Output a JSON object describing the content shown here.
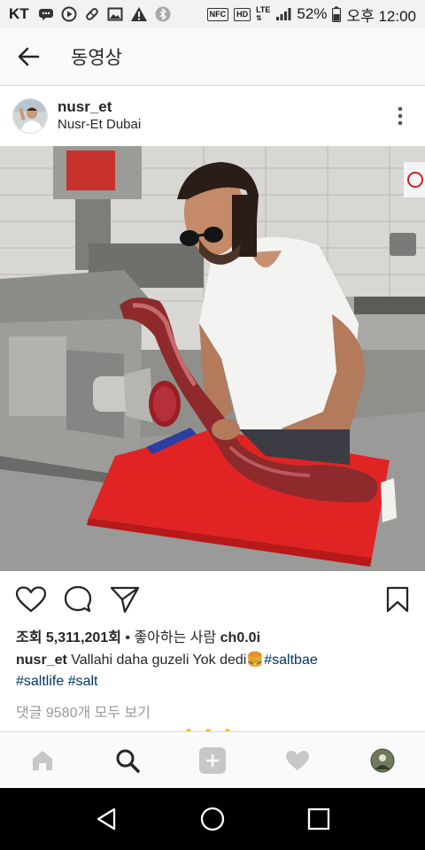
{
  "status_bar": {
    "carrier": "KT",
    "nfc": "NFC",
    "hd": "HD",
    "lte": "LTE",
    "battery": "52%",
    "time": "오후 12:00"
  },
  "header": {
    "title": "동영상"
  },
  "post": {
    "username": "nusr_et",
    "location": "Nusr-Et Dubai"
  },
  "stats": {
    "views_label": "조회",
    "views_count": "5,311,201회",
    "liked_by": "• 좋아하는 사람",
    "liked_user": "ch0.0i"
  },
  "caption": {
    "user": "nusr_et",
    "text": " Vallahi  daha guzeli Yok dedi",
    "emoji": "🍔",
    "tags": [
      "#saltbae",
      "#saltlife",
      "#salt"
    ]
  },
  "comments": {
    "link": "댓글 9580개 모두 보기"
  },
  "colors": {
    "hashtag": "#003569",
    "muted": "#999999",
    "text": "#262626",
    "cutting_board": "#e02424"
  },
  "icons": {
    "back": "arrow-left-icon",
    "more": "vertical-dots-icon",
    "like": "heart-icon",
    "comment": "speech-bubble-icon",
    "share": "paper-plane-icon",
    "save": "bookmark-icon",
    "home": "home-icon",
    "search": "search-icon",
    "add": "add-icon",
    "activity": "heart-icon",
    "profile": "avatar-icon"
  }
}
